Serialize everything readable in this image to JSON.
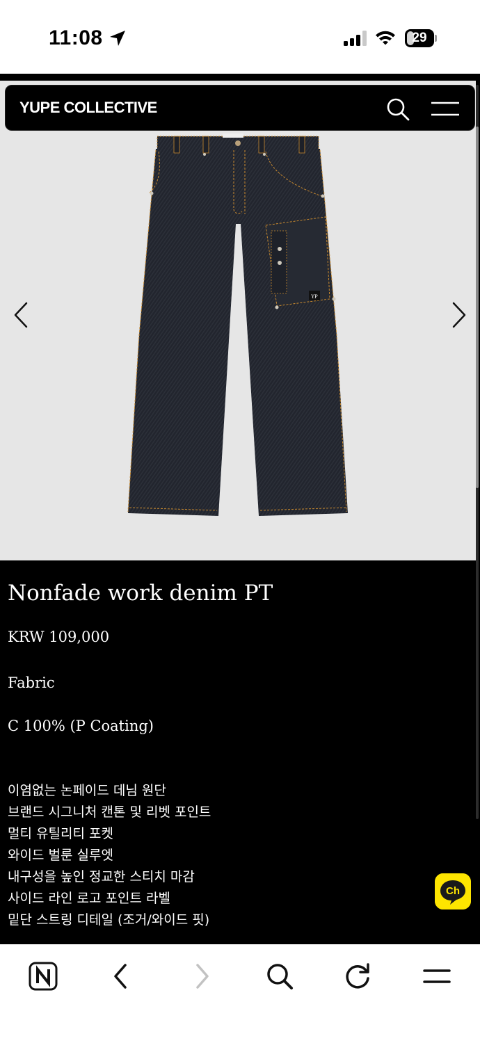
{
  "status_bar": {
    "time": "11:08",
    "battery_level": "29",
    "battery_fraction": 0.29,
    "icons": [
      "location-arrow-icon",
      "cellular-signal-icon",
      "wifi-icon",
      "battery-icon"
    ]
  },
  "header": {
    "logo": "YUPE COLLECTIVE",
    "icons": [
      "search-icon",
      "hamburger-menu-icon"
    ]
  },
  "gallery": {
    "image": "navy denim wide work pants",
    "label_on_pocket": "YP",
    "prev_icon": "chevron-left-icon",
    "next_icon": "chevron-right-icon"
  },
  "product": {
    "title": "Nonfade work denim PT",
    "price": "KRW 109,000",
    "fabric_label": "Fabric",
    "fabric_value": "C 100% (P Coating)",
    "features": [
      "이염없는 논페이드 데님 원단",
      "브랜드 시그니처 캔톤 및 리벳 포인트",
      "멀티 유틸리티 포켓",
      "와이드 벌룬 실루엣",
      "내구성을 높인 정교한 스티치 마감",
      "사이드 라인 로고 포인트 라벨",
      "밑단 스트링 디테일 (조거/와이드 핏)"
    ]
  },
  "kakao_channel": {
    "label": "Ch",
    "color": "#FEE500"
  },
  "toolbar": {
    "icons": [
      "naver-home-icon",
      "back-icon",
      "forward-icon",
      "search-icon",
      "reload-icon",
      "menu-icon"
    ]
  },
  "colors": {
    "background": "#000000",
    "gallery_bg": "#E6E6E6",
    "denim": "#23262f",
    "stitch": "#c8892e"
  }
}
